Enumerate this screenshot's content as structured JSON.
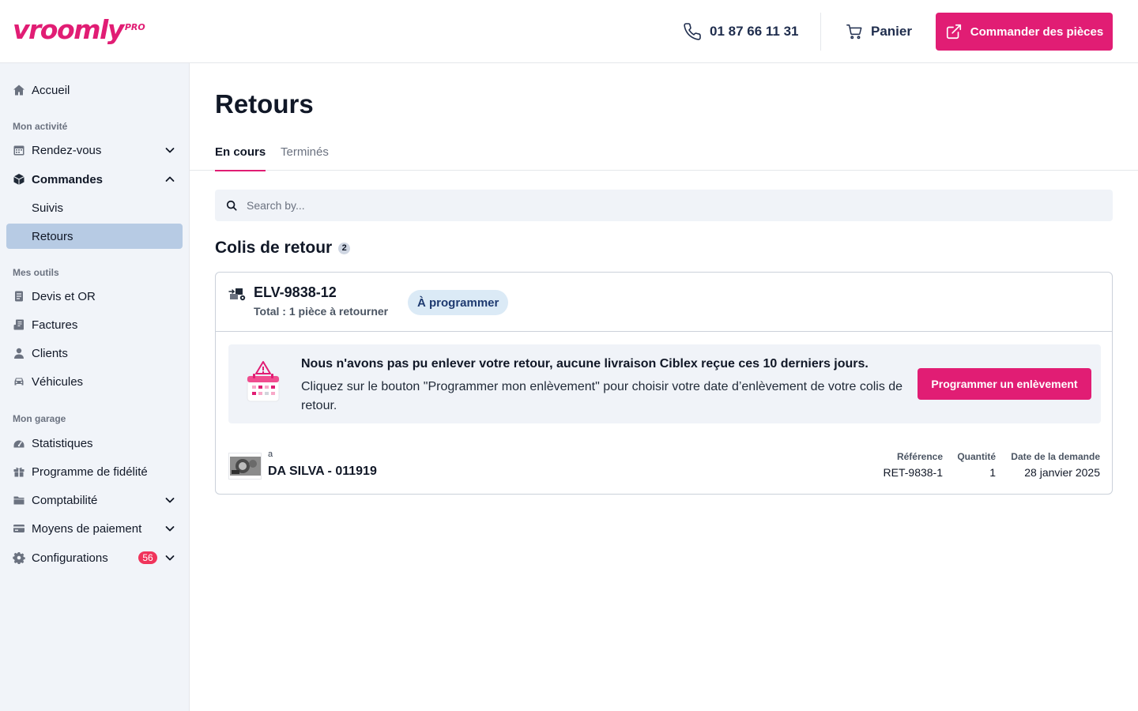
{
  "header": {
    "logo": "vroomly",
    "logo_suffix": "PRO",
    "phone": "01 87 66 11 31",
    "cart_label": "Panier",
    "order_button": "Commander des pièces"
  },
  "sidebar": {
    "home": "Accueil",
    "section_activity": "Mon activité",
    "appointments": "Rendez-vous",
    "orders": "Commandes",
    "orders_sub": [
      "Suivis",
      "Retours"
    ],
    "section_tools": "Mes outils",
    "quotes": "Devis et OR",
    "invoices": "Factures",
    "clients": "Clients",
    "vehicles": "Véhicules",
    "section_garage": "Mon garage",
    "stats": "Statistiques",
    "loyalty": "Programme de fidélité",
    "accounting": "Comptabilité",
    "payment": "Moyens de paiement",
    "config": "Configurations",
    "config_badge": "56"
  },
  "main": {
    "title": "Retours",
    "tabs": [
      "En cours",
      "Terminés"
    ],
    "search_placeholder": "Search by...",
    "section_title": "Colis de retour",
    "section_count": "2",
    "parcel": {
      "id": "ELV-9838-12",
      "total": "Total : 1 pièce à retourner",
      "status": "À programmer",
      "alert_title": "Nous n'avons pas pu enlever votre retour, aucune livraison Ciblex reçue ces 10 derniers jours.",
      "alert_text": "Cliquez sur le bouton \"Programmer mon enlèvement\" pour choisir votre date d’enlèvement de votre colis de retour.",
      "alert_button": "Programmer un enlèvement",
      "item_sub": "a",
      "item_name": "DA SILVA - 011919",
      "ref_label": "Référence",
      "ref_value": "RET-9838-1",
      "qty_label": "Quantité",
      "qty_value": "1",
      "date_label": "Date de la demande",
      "date_value": "28 janvier 2025"
    }
  },
  "colors": {
    "brand": "#e11d74",
    "sidebar_bg": "#f1f4f9",
    "active_item": "#b7cbe4",
    "status_pill": "#dbeaf6",
    "badge": "#f0345b"
  }
}
